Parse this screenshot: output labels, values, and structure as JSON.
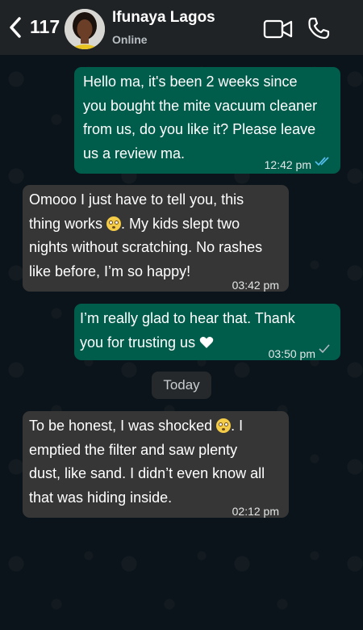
{
  "header": {
    "unread_count": "117",
    "contact_name": "Ifunaya Lagos",
    "status": "Online",
    "icons": [
      "back-arrow-icon",
      "video-call-icon",
      "phone-call-icon"
    ]
  },
  "messages": [
    {
      "direction": "outgoing",
      "text": "Hello ma, it's been 2 weeks since\nyou bought the mite vacuum cleaner\nfrom us, do you like it? Please leave\nus a review ma.",
      "time": "12:42 pm",
      "receipt": "read"
    },
    {
      "direction": "incoming",
      "text_before": " Omooo I just have to tell you, this\nthing works ",
      "emoji": "flushed-face-emoji",
      "text_after": ". My kids slept two\nnights without scratching. No rashes\nlike before, I’m so happy!",
      "time": "03:42 pm"
    },
    {
      "direction": "outgoing",
      "text": " I’m really glad to hear that. Thank\nyou for trusting us",
      "emoji": "white-heart-emoji",
      "time": "03:50 pm",
      "receipt": "delivered"
    },
    {
      "direction": "incoming",
      "text_before": " To be honest, I was shocked ",
      "emoji": "flushed-face-emoji",
      "text_after": ". I\nemptied the filter and saw plenty\ndust, like sand. I didn’t even know all\nthat was hiding inside.",
      "time": "02:12 pm"
    }
  ],
  "date_divider": "Today",
  "colors": {
    "background": "#0b141a",
    "header": "#1f2326",
    "outgoing_bubble": "#005c4b",
    "incoming_bubble": "#363636",
    "read_ticks": "#53bdeb"
  }
}
